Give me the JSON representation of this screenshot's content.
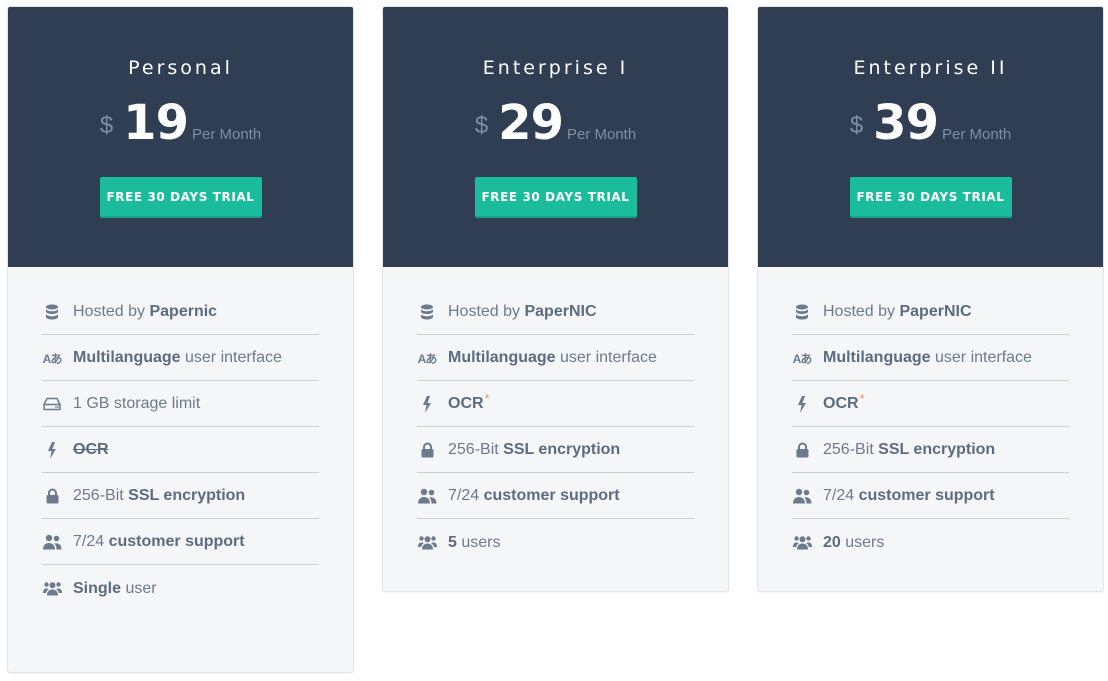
{
  "colors": {
    "header_bg": "#2f3e52",
    "card_bg": "#f5f6f8",
    "button_bg": "#1abc9c",
    "text": "#6b7a8d",
    "asterisk": "#e8926b"
  },
  "plans": [
    {
      "name": "Personal",
      "currency": "$",
      "price": "19",
      "period": "Per Month",
      "cta": "FREE 30 DAYS TRIAL",
      "features": [
        {
          "icon": "database-icon",
          "pre": "Hosted by ",
          "bold": "Papernic",
          "post": ""
        },
        {
          "icon": "language-icon",
          "icon_text": "Aあ",
          "pre": "",
          "bold": "Multilanguage",
          "post": " user interface"
        },
        {
          "icon": "hard-drive-icon",
          "pre": "1 GB storage limit",
          "bold": "",
          "post": ""
        },
        {
          "icon": "bolt-icon",
          "pre": "",
          "bold": "OCR",
          "post": "",
          "strikethrough": true
        },
        {
          "icon": "lock-icon",
          "pre": "256-Bit ",
          "bold": "SSL encryption",
          "post": ""
        },
        {
          "icon": "support-icon",
          "pre": "7/24 ",
          "bold": "customer support",
          "post": ""
        },
        {
          "icon": "users-icon",
          "pre": "",
          "bold": "Single",
          "post": " user"
        }
      ]
    },
    {
      "name": "Enterprise I",
      "currency": "$",
      "price": "29",
      "period": "Per Month",
      "cta": "FREE 30 DAYS TRIAL",
      "features": [
        {
          "icon": "database-icon",
          "pre": "Hosted by ",
          "bold": "PaperNIC",
          "post": ""
        },
        {
          "icon": "language-icon",
          "icon_text": "Aあ",
          "pre": "",
          "bold": "Multilanguage",
          "post": " user interface"
        },
        {
          "icon": "bolt-icon",
          "pre": "",
          "bold": "OCR",
          "post": "",
          "asterisk": "*"
        },
        {
          "icon": "lock-icon",
          "pre": "256-Bit ",
          "bold": "SSL encryption",
          "post": ""
        },
        {
          "icon": "support-icon",
          "pre": "7/24 ",
          "bold": "customer support",
          "post": ""
        },
        {
          "icon": "users-icon",
          "pre": "",
          "bold": "5",
          "post": " users"
        }
      ]
    },
    {
      "name": "Enterprise II",
      "currency": "$",
      "price": "39",
      "period": "Per Month",
      "cta": "FREE 30 DAYS TRIAL",
      "features": [
        {
          "icon": "database-icon",
          "pre": "Hosted by ",
          "bold": "PaperNIC",
          "post": ""
        },
        {
          "icon": "language-icon",
          "icon_text": "Aあ",
          "pre": "",
          "bold": "Multilanguage",
          "post": " user interface"
        },
        {
          "icon": "bolt-icon",
          "pre": "",
          "bold": "OCR",
          "post": "",
          "asterisk": "*"
        },
        {
          "icon": "lock-icon",
          "pre": "256-Bit ",
          "bold": "SSL encryption",
          "post": ""
        },
        {
          "icon": "support-icon",
          "pre": "7/24 ",
          "bold": "customer support",
          "post": ""
        },
        {
          "icon": "users-icon",
          "pre": "",
          "bold": "20",
          "post": " users"
        }
      ]
    }
  ]
}
